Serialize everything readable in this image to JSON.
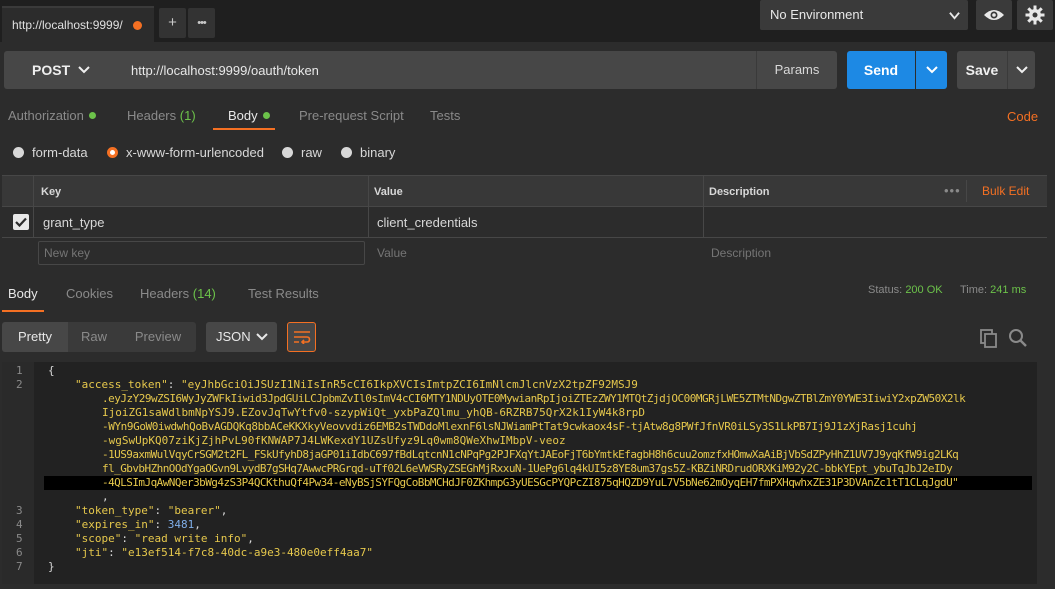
{
  "tabs": {
    "active_title": "http://localhost:9999/",
    "add_label": "+",
    "more_label": "•••"
  },
  "environment": {
    "selected": "No Environment"
  },
  "request": {
    "method": "POST",
    "url": "http://localhost:9999/oauth/token",
    "params_label": "Params",
    "send_label": "Send",
    "save_label": "Save"
  },
  "request_tabs": {
    "authorization": "Authorization",
    "headers": "Headers",
    "headers_count": "(1)",
    "body": "Body",
    "prerequest": "Pre-request Script",
    "tests": "Tests",
    "code": "Code"
  },
  "body_types": {
    "form_data": "form-data",
    "urlencoded": "x-www-form-urlencoded",
    "raw": "raw",
    "binary": "binary",
    "selected": "x-www-form-urlencoded"
  },
  "kv_table": {
    "headers": {
      "key": "Key",
      "value": "Value",
      "description": "Description"
    },
    "bulk_edit": "Bulk Edit",
    "rows": [
      {
        "enabled": true,
        "key": "grant_type",
        "value": "client_credentials",
        "description": ""
      }
    ],
    "placeholders": {
      "key": "New key",
      "value": "Value",
      "description": "Description"
    }
  },
  "response_tabs": {
    "body": "Body",
    "cookies": "Cookies",
    "headers": "Headers",
    "headers_count": "(14)",
    "test_results": "Test Results"
  },
  "response_status": {
    "status_label": "Status:",
    "status_value": "200 OK",
    "time_label": "Time:",
    "time_value": "241 ms"
  },
  "response_view": {
    "pretty": "Pretty",
    "raw": "Raw",
    "preview": "Preview",
    "format": "JSON"
  },
  "response_json": {
    "line_numbers": [
      "1",
      "2",
      "3",
      "4",
      "5",
      "6",
      "7"
    ],
    "open_brace": "{",
    "close_brace": "}",
    "access_token_key": "\"access_token\"",
    "access_token_lines": [
      "\"eyJhbGciOiJSUzI1NiIsInR5cCI6IkpXVCIsImtpZCI6ImNlcmJlcnVzX2tpZF92MSJ9",
      ".eyJzY29wZSI6WyJyZWFkIiwid3JpdGUiLCJpbmZvIl0sImV4cCI6MTY1NDUyOTE0MywianRpIjoiZTEzZWY1MTQtZjdjOC00MGRjLWE5ZTMtNDgwZTBlZmY0YWE3IiwiY2xpZW50X2lk",
      "IjoiZG1saWdlbmNpYSJ9.EZovJqTwYtfv0-szypWiQt_yxbPaZQlmu_yhQB-6RZRB75QrX2k1IyW4k8rpD",
      "-WYn9GoW0iwdwhQoBvAGDQKq8bbACeKKXkyVeovvdiz6EMB2sTWDdoMlexnF6lsNJWiamPtTat9cwkaox4sF-tjAtw8g8PWfJfnVR0iLSy3S1LkPB7Ij9J1zXjRasj1cuhj",
      "-wgSwUpKQ07ziKjZjhPvL90fKNWAP7J4LWKexdY1UZsUfyz9Lq0wm8QWeXhwIMbpV-veoz",
      "-1US9axmWulVqyCrSGM2t2FL_FSkUfyhD8jaGP01iIdbC697fBdLqtcnN1cNPqPg2PJFXqYtJAEoFjT6bYmtkEfagbH8h6cuu2omzfxHOmwXaAiBjVbSdZPyHhZ1UV7J9yqKfW9ig2LKq",
      "fl_GbvbHZhnOOdYgaOGvn9LvydB7gSHq7AwwcPRGrqd-uTf02L6eVWSRyZSEGhMjRxxuN-1UePg6lq4kUI5z8YE8um37gs5Z-KBZiNRDrudORXKiM92y2C-bbkYEpt_ybuTqJbJ2eIDy",
      "-4QLSImJqAwNQer3bWg4zS3P4QCKthuQf4Pw34-eNyBSjSYFQgCoBbMCHdJF0ZKhmpG3yUESGcPYQPcZI875qHQZD9YuL7V5bNe62mOyqEH7fmPXHqwhxZE31P3DVAnZc1tT1CLqJgdU\""
    ],
    "token_type_key": "\"token_type\"",
    "token_type_value": "\"bearer\"",
    "expires_in_key": "\"expires_in\"",
    "expires_in_value": "3481",
    "scope_key": "\"scope\"",
    "scope_value": "\"read write info\"",
    "jti_key": "\"jti\"",
    "jti_value": "\"e13ef514-f7c8-40dc-a9e3-480e0eff4aa7\""
  },
  "colors": {
    "accent": "#f47023",
    "send_blue": "#1d89e4",
    "success_green": "#6cc24a"
  }
}
